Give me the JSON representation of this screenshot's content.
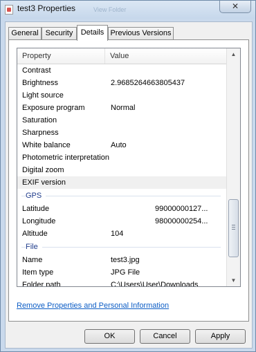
{
  "window": {
    "title": "test3 Properties",
    "ghost_title": "View Folder",
    "close_glyph": "✕"
  },
  "tabs": [
    {
      "label": "General"
    },
    {
      "label": "Security"
    },
    {
      "label": "Details",
      "active": true
    },
    {
      "label": "Previous Versions"
    }
  ],
  "list": {
    "columns": {
      "property": "Property",
      "value": "Value"
    },
    "rows_top": [
      {
        "property": "Contrast",
        "value": ""
      },
      {
        "property": "Brightness",
        "value": "2.9685264663805437"
      },
      {
        "property": "Light source",
        "value": ""
      },
      {
        "property": "Exposure program",
        "value": "Normal"
      },
      {
        "property": "Saturation",
        "value": ""
      },
      {
        "property": "Sharpness",
        "value": ""
      },
      {
        "property": "White balance",
        "value": "Auto"
      },
      {
        "property": "Photometric interpretation",
        "value": ""
      },
      {
        "property": "Digital zoom",
        "value": ""
      },
      {
        "property": "EXIF version",
        "value": ""
      }
    ],
    "group_gps": "GPS",
    "rows_gps": [
      {
        "property": "Latitude",
        "value": "99000000127..."
      },
      {
        "property": "Longitude",
        "value": "98000000254..."
      },
      {
        "property": "Altitude",
        "value": "104"
      }
    ],
    "group_file": "File",
    "rows_file": [
      {
        "property": "Name",
        "value": "test3.jpg"
      },
      {
        "property": "Item type",
        "value": "JPG File"
      },
      {
        "property": "Folder path",
        "value": "C:\\Users\\User\\Downloads"
      }
    ]
  },
  "remove_link": "Remove Properties and Personal Information",
  "buttons": {
    "ok": "OK",
    "cancel": "Cancel",
    "apply": "Apply"
  },
  "icons": {
    "scroll_up": "▲",
    "scroll_down": "▼"
  }
}
